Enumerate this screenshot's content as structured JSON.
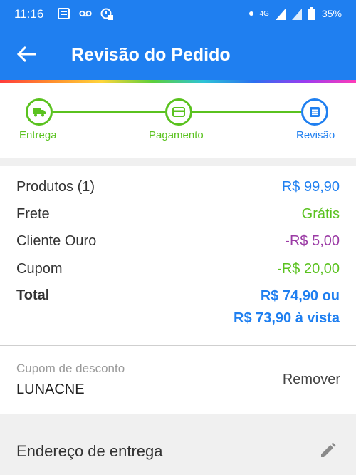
{
  "status_bar": {
    "time": "11:16",
    "network": "4G",
    "battery": "35%",
    "icons": [
      "news-icon",
      "voicemail-icon",
      "alarm-icon",
      "dot-icon",
      "data-arrows-icon",
      "signal-icon",
      "signal-x-icon",
      "battery-icon"
    ]
  },
  "app_bar": {
    "title": "Revisão do Pedido",
    "back_icon": "arrow-back-icon"
  },
  "stepper": {
    "steps": [
      {
        "label": "Entrega",
        "icon": "truck-icon",
        "state": "done"
      },
      {
        "label": "Pagamento",
        "icon": "card-icon",
        "state": "done"
      },
      {
        "label": "Revisão",
        "icon": "receipt-icon",
        "state": "current"
      }
    ],
    "colors": {
      "done": "#5ac21f",
      "current": "#1f7ff0"
    }
  },
  "summary": {
    "products_label": "Produtos (1)",
    "products_value": "R$ 99,90",
    "shipping_label": "Frete",
    "shipping_value": "Grátis",
    "gold_label": "Cliente Ouro",
    "gold_value": "-R$ 5,00",
    "coupon_label": "Cupom",
    "coupon_value": "-R$ 20,00",
    "total_label": "Total",
    "total_line1": "R$ 74,90 ou",
    "total_line2": "R$ 73,90 à vista"
  },
  "coupon_section": {
    "title": "Cupom de desconto",
    "code": "LUNACNE",
    "remove_label": "Remover"
  },
  "address_section": {
    "title": "Endereço de entrega",
    "edit_icon": "pencil-icon"
  },
  "colors": {
    "primary": "#1f7ff0",
    "green": "#5ac21f",
    "purple": "#9b3ba5"
  }
}
